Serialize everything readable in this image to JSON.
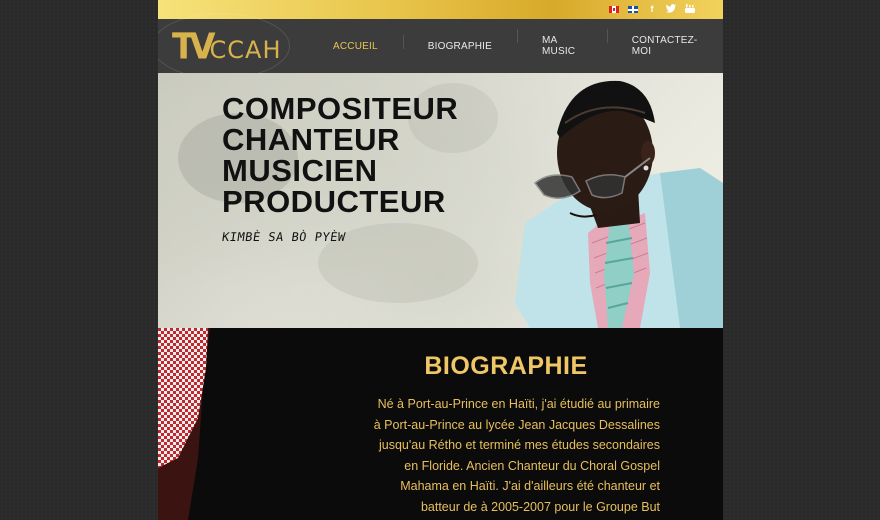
{
  "topbar": {
    "social": [
      "f",
      "t",
      "yt"
    ]
  },
  "logo": {
    "mark": "TV",
    "rest": "CCAH"
  },
  "nav": {
    "items": [
      "ACCUEIL",
      "BIOGRAPHIE",
      "MA MUSIC",
      "CONTACTEZ-MOI"
    ],
    "active_index": 0
  },
  "hero": {
    "lines": [
      "COMPOSITEUR",
      "CHANTEUR",
      "MUSICIEN",
      "PRODUCTEUR"
    ],
    "tagline": "KIMBÈ SA BÒ PYÈW"
  },
  "bio": {
    "title": "BIOGRAPHIE",
    "paragraph": [
      "Né à Port-au-Prince en Haïti, j'ai étudié au primaire",
      "à Port-au-Prince au lycée Jean Jacques Dessalines",
      "jusqu'au Rétho et terminé mes études secondaires",
      "en Floride. Ancien Chanteur du Choral Gospel",
      "Mahama en Haïti. J'ai d'ailleurs été chanteur et",
      "batteur de à 2005-2007 pour le Groupe But"
    ]
  },
  "colors": {
    "gold": "#e9c453",
    "nav_bg": "#3c3c3c",
    "bio_text": "#e7bf5d"
  }
}
